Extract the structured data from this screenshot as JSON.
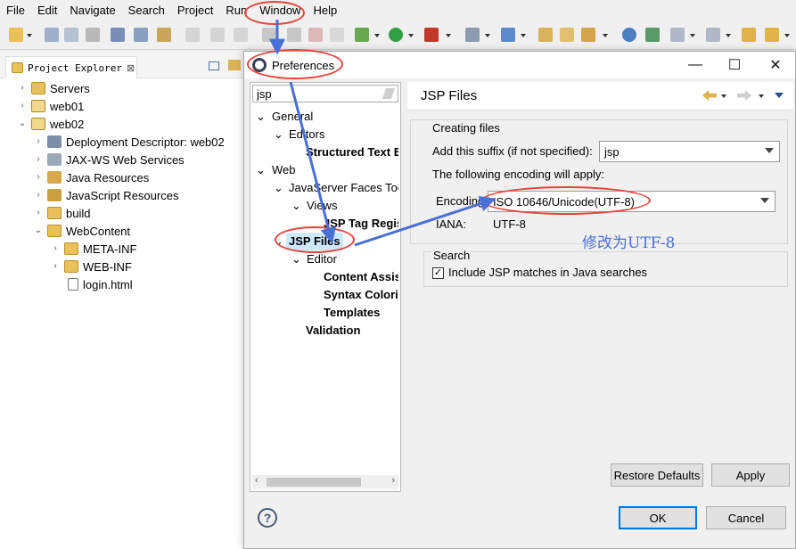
{
  "menubar": {
    "items": [
      "File",
      "Edit",
      "Navigate",
      "Search",
      "Project",
      "Run",
      "Window",
      "Help"
    ]
  },
  "explorer": {
    "tab_label": "Project Explorer",
    "close_glyph": "⊠",
    "tree": [
      {
        "label": "Servers",
        "icon": "folder-icon"
      },
      {
        "label": "web01",
        "icon": "project-icon"
      },
      {
        "label": "web02",
        "icon": "project-icon"
      },
      {
        "label": "Deployment Descriptor: web02",
        "icon": "descriptor-icon"
      },
      {
        "label": "JAX-WS Web Services",
        "icon": "webservice-icon"
      },
      {
        "label": "Java Resources",
        "icon": "java-resources-icon"
      },
      {
        "label": "JavaScript Resources",
        "icon": "javascript-icon"
      },
      {
        "label": "build",
        "icon": "folder-icon"
      },
      {
        "label": "WebContent",
        "icon": "folder-icon"
      },
      {
        "label": "META-INF",
        "icon": "folder-icon"
      },
      {
        "label": "WEB-INF",
        "icon": "folder-icon"
      },
      {
        "label": "login.html",
        "icon": "file-icon"
      }
    ]
  },
  "dialog": {
    "title": "Preferences",
    "filter_value": "jsp",
    "tree": [
      {
        "label": "General"
      },
      {
        "label": "Editors"
      },
      {
        "label": "Structured Text E"
      },
      {
        "label": "Web"
      },
      {
        "label": "JavaServer Faces Too"
      },
      {
        "label": "Views"
      },
      {
        "label": "JSP Tag Regis"
      },
      {
        "label": "JSP Files"
      },
      {
        "label": "Editor"
      },
      {
        "label": "Content Assis"
      },
      {
        "label": "Syntax Colori"
      },
      {
        "label": "Templates"
      },
      {
        "label": "Validation"
      }
    ],
    "page_title": "JSP Files",
    "creating_files": {
      "group_label": "Creating files",
      "suffix_label": "Add this suffix (if not specified):",
      "suffix_value": "jsp",
      "encoding_note": "The following encoding will apply:",
      "encoding_label": "Encoding:",
      "encoding_value": "ISO 10646/Unicode(UTF-8)",
      "iana_label": "IANA:",
      "iana_value": "UTF-8"
    },
    "search": {
      "group_label": "Search",
      "checkbox_label": "Include JSP matches in Java searches",
      "checked": true
    },
    "restore_defaults": "Restore Defaults",
    "apply": "Apply",
    "ok": "OK",
    "cancel": "Cancel",
    "help_glyph": "?"
  },
  "annotation": {
    "text": "修改为UTF-8",
    "color": "#4a6fd6"
  },
  "colors": {
    "highlight": "#e8433a",
    "arrow": "#4a6fd6"
  }
}
